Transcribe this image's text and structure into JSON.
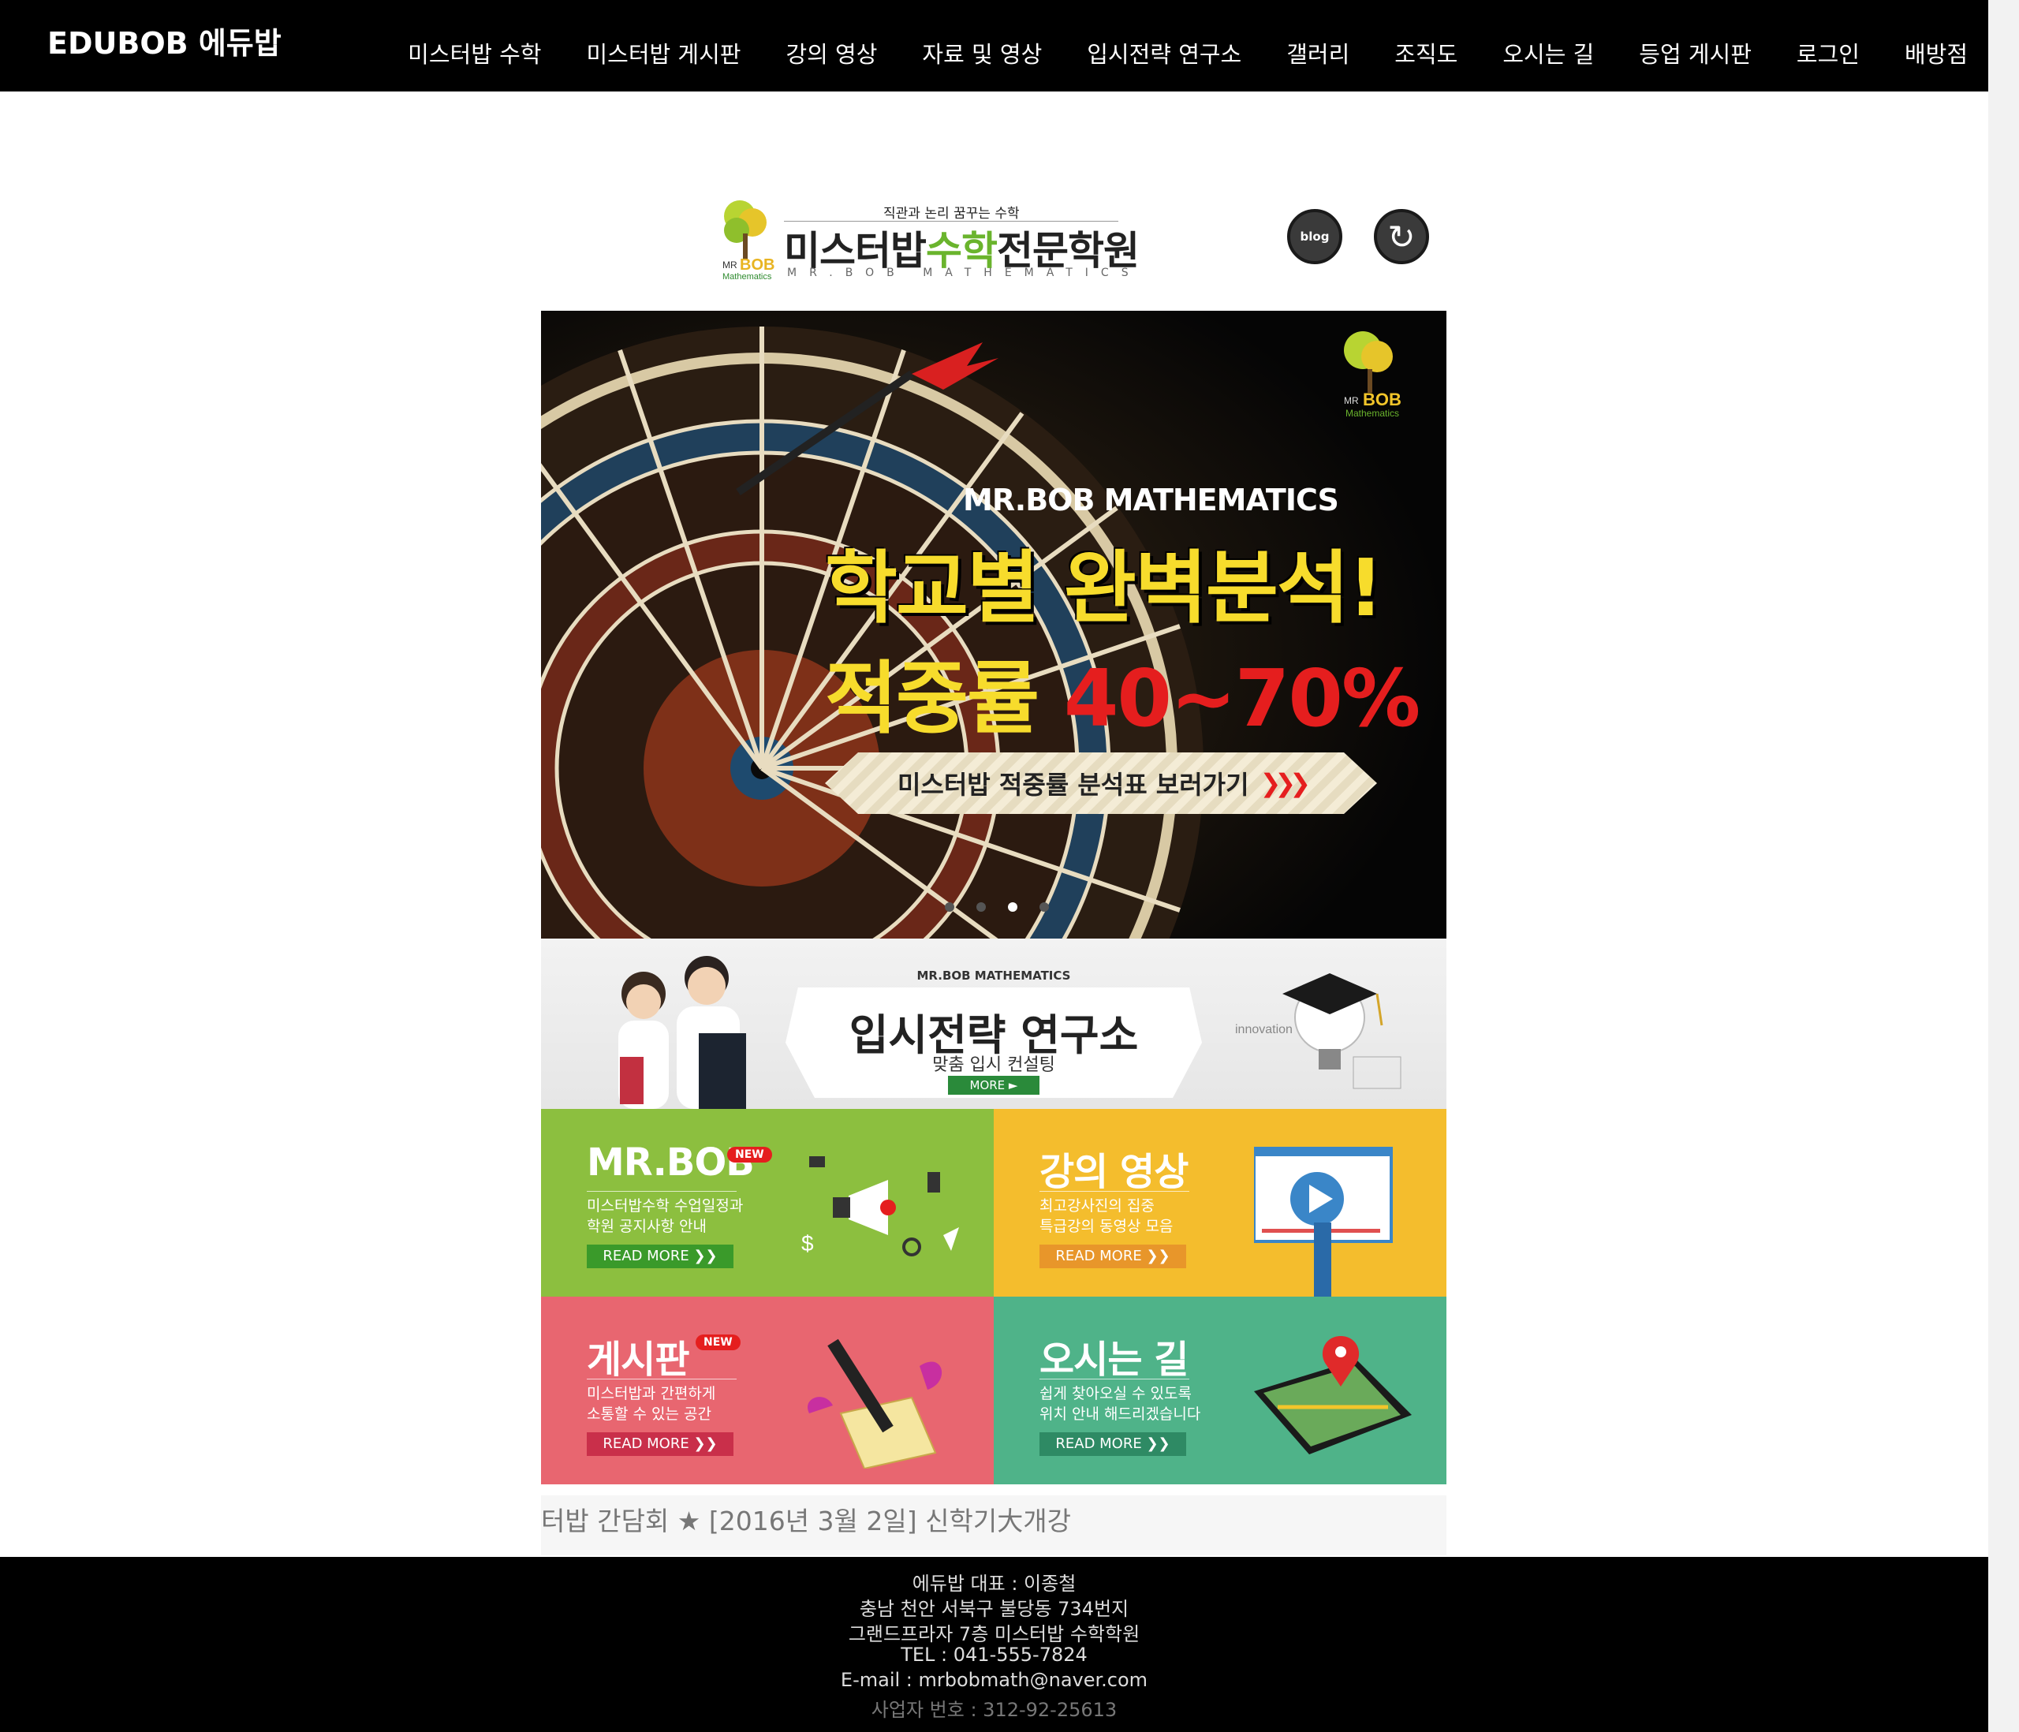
{
  "brand": "EDUBOB 에듀밥",
  "nav": [
    "미스터밥 수학",
    "미스터밥 게시판",
    "강의 영상",
    "자료 및 영상",
    "입시전략 연구소",
    "갤러리",
    "조직도",
    "오시는 길",
    "등업 게시판",
    "로그인",
    "배방점"
  ],
  "logo": {
    "tagline": "직관과 논리 꿈꾸는 수학",
    "name_prefix": "미스터밥",
    "name_accent": "수학",
    "name_suffix": "전문학원",
    "sub": "MR.BOB MATHEMATICS",
    "mark_text": "MR BOB",
    "mark_sub": "Mathematics"
  },
  "social": {
    "blog_label": "blog",
    "refresh_icon": "↻"
  },
  "hero": {
    "eyebrow": "MR.BOB MATHEMATICS",
    "title": "학교별 완벽분석!",
    "sub_prefix": "적중률",
    "sub_rate": "40~70%",
    "cta_label": "미스터밥 적중률 분석표 보러가기",
    "cta_arrows": "❯❯❯",
    "slides": 4,
    "active_slide": 3,
    "mark_text": "MR BOB",
    "mark_sub": "Mathematics",
    "colors": {
      "title": "#f7dc2c",
      "rate": "#e51e1e"
    }
  },
  "strategy": {
    "eyebrow": "MR.BOB MATHEMATICS",
    "title": "입시전략 연구소",
    "sub": "맞춤 입시 컨설팅",
    "more": "MORE ►"
  },
  "tiles": [
    {
      "title": "MR.BOB",
      "badge": "NEW",
      "desc1": "미스터밥수학 수업일정과",
      "desc2": "학원 공지사항 안내",
      "more": "READ MORE ❯❯",
      "color": "#8cbf3f"
    },
    {
      "title": "강의 영상",
      "badge": "",
      "desc1": "최고강사진의 집중",
      "desc2": "특급강의 동영상 모음",
      "more": "READ MORE ❯❯",
      "color": "#f4bd2d"
    },
    {
      "title": "게시판",
      "badge": "NEW",
      "desc1": "미스터밥과 간편하게",
      "desc2": "소통할 수 있는 공간",
      "more": "READ MORE ❯❯",
      "color": "#e86670"
    },
    {
      "title": "오시는 길",
      "badge": "",
      "desc1": "쉽게 찾아오실 수 있도록",
      "desc2": "위치 안내 해드리겠습니다",
      "more": "READ MORE ❯❯",
      "color": "#4fb389"
    }
  ],
  "ticker": "터밥 간담회 ★ [2016년 3월 2일] 신학기大개강",
  "footer": [
    "에듀밥 대표 : 이종철",
    "충남 천안 서북구 불당동 734번지",
    "그랜드프라자 7층 미스터밥 수학학원",
    "TEL : 041-555-7824",
    "E-mail : mrbobmath@naver.com",
    "사업자 번호 : 312-92-25613"
  ]
}
